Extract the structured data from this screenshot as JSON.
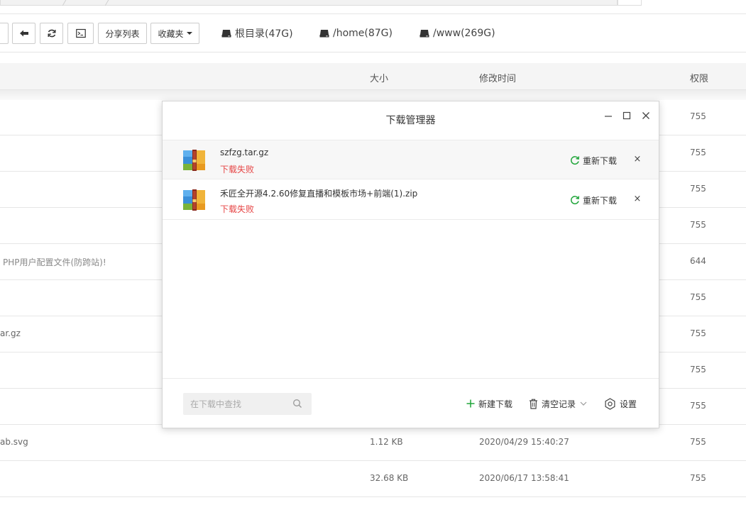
{
  "toolbar": {
    "share_list": "分享列表",
    "favorites": "收藏夹",
    "disks": [
      {
        "label": "根目录(47G)"
      },
      {
        "label": "/home(87G)"
      },
      {
        "label": "/www(269G)"
      }
    ]
  },
  "table": {
    "columns": {
      "size": "大小",
      "modified": "修改时间",
      "permission": "权限"
    },
    "rows": [
      {
        "name": "",
        "size": "",
        "modified": "",
        "perm": "755"
      },
      {
        "name": "",
        "size": "",
        "modified": "",
        "perm": "755"
      },
      {
        "name": "",
        "size": "",
        "modified": "",
        "perm": "755"
      },
      {
        "name": "",
        "size": "",
        "modified": "",
        "perm": "755"
      },
      {
        "name": "PHP用户配置文件(防跨站)!",
        "size": "",
        "modified": "",
        "perm": "644"
      },
      {
        "name": "",
        "size": "",
        "modified": "",
        "perm": "755"
      },
      {
        "name": "ar.gz",
        "size": "",
        "modified": "",
        "perm": "755"
      },
      {
        "name": "",
        "size": "",
        "modified": "",
        "perm": "755"
      },
      {
        "name": "",
        "size": "",
        "modified": "",
        "perm": "755"
      },
      {
        "name": "ab.svg",
        "size": "1.12 KB",
        "modified": "2020/04/29 15:40:27",
        "perm": "755"
      },
      {
        "name": "",
        "size": "32.68 KB",
        "modified": "2020/06/17 13:58:41",
        "perm": "755"
      }
    ]
  },
  "download_manager": {
    "title": "下载管理器",
    "items": [
      {
        "name": "szfzg.tar.gz",
        "status": "下载失败",
        "retry": "重新下载",
        "remove": "×"
      },
      {
        "name": "禾匠全开源4.2.60修复直播和模板市场+前端(1).zip",
        "status": "下载失败",
        "retry": "重新下载",
        "remove": "×"
      }
    ],
    "search_placeholder": "在下载中查找",
    "new_download": "新建下载",
    "clear_records": "清空记录",
    "settings": "设置"
  },
  "colors": {
    "failed": "#e64545",
    "accent_green": "#20a53a"
  }
}
